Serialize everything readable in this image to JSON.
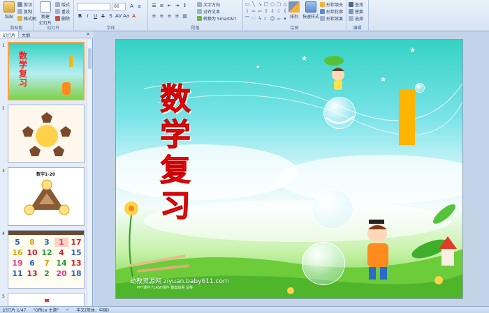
{
  "ribbon": {
    "clipboard": {
      "paste": "粘贴",
      "cut": "剪切",
      "copy": "复制",
      "format_painter": "格式刷",
      "label": "剪贴板"
    },
    "slides": {
      "new_slide": "新建\n幻灯片",
      "layout": "版式",
      "reset": "重设",
      "delete": "删除",
      "label": "幻灯片"
    },
    "font": {
      "font_name": "",
      "font_size": "66",
      "label": "字体"
    },
    "paragraph": {
      "label": "段落",
      "text_direction": "文字方向",
      "align_text": "对齐文本",
      "smartart": "转换为 SmartArt"
    },
    "drawing": {
      "arrange": "排列",
      "quick_styles": "快速样式",
      "shape_fill": "形状填充",
      "shape_outline": "形状轮廓",
      "shape_effects": "形状效果",
      "label": "绘图"
    },
    "editing": {
      "find": "查找",
      "replace": "替换",
      "select": "选择",
      "label": "编辑"
    }
  },
  "panel": {
    "tabs": [
      "幻灯片",
      "大纲"
    ],
    "close": "×",
    "slides": [
      {
        "num": "1",
        "title": "数学复习"
      },
      {
        "num": "2",
        "title": ""
      },
      {
        "num": "3",
        "title": "数字1-20"
      },
      {
        "num": "4",
        "title": ""
      },
      {
        "num": "5",
        "title": ""
      }
    ],
    "grid_numbers": [
      [
        "5",
        "8",
        "3",
        "1",
        "17"
      ],
      [
        "16",
        "10",
        "12",
        "4",
        "15"
      ],
      [
        "19",
        "6",
        "7",
        "14",
        "13"
      ],
      [
        "11",
        "13",
        "2",
        "20",
        "18"
      ]
    ]
  },
  "slide": {
    "title": "数学复习",
    "watermark": "幼教资源网 ziyuan.baby611.com",
    "watermark_sub": "PPT课件 FLASH课件 教案故事 试卷"
  },
  "status": {
    "slide_of": "幻灯片 1/47",
    "theme": "\"Office 主题\"",
    "language": "中文(简体，中国)"
  },
  "colors": {
    "title_red": "#ff1a1a",
    "accent_bar": "#ffb400",
    "ribbon_bg": "#d6e3f3"
  }
}
